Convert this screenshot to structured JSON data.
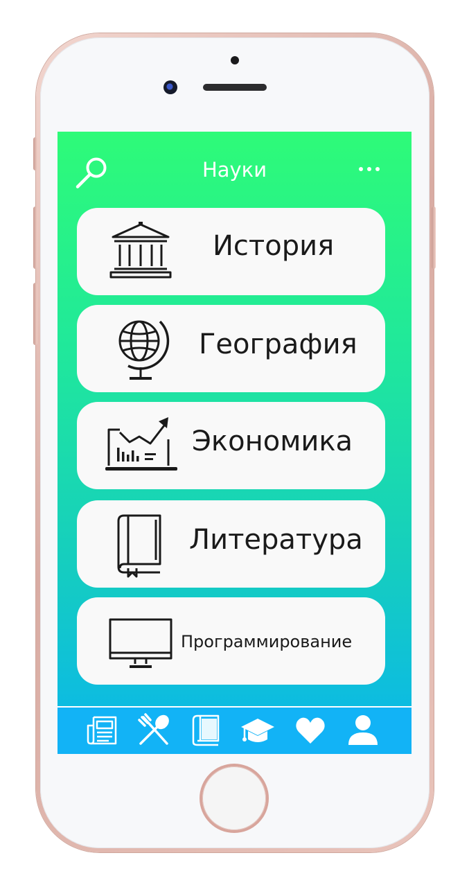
{
  "header": {
    "title": "Науки",
    "search_icon": "search-icon",
    "more_icon": "more-horizontal-icon"
  },
  "subjects": [
    {
      "label": "История",
      "icon": "museum-building-icon"
    },
    {
      "label": "География",
      "icon": "globe-icon"
    },
    {
      "label": "Экономика",
      "icon": "growth-chart-laptop-icon"
    },
    {
      "label": "Литература",
      "icon": "book-icon"
    },
    {
      "label": "Программирование",
      "icon": "computer-monitor-icon"
    }
  ],
  "tabbar": [
    {
      "icon": "newspaper-icon"
    },
    {
      "icon": "fork-spoon-icon"
    },
    {
      "icon": "book-icon"
    },
    {
      "icon": "graduation-cap-icon"
    },
    {
      "icon": "heart-icon"
    },
    {
      "icon": "user-icon"
    }
  ],
  "colors": {
    "gradient_top": "#2efb78",
    "gradient_bottom": "#0ab6ec",
    "tabbar": "#12b3f6",
    "card": "#f9f9f9",
    "text": "#1a1a1a"
  }
}
